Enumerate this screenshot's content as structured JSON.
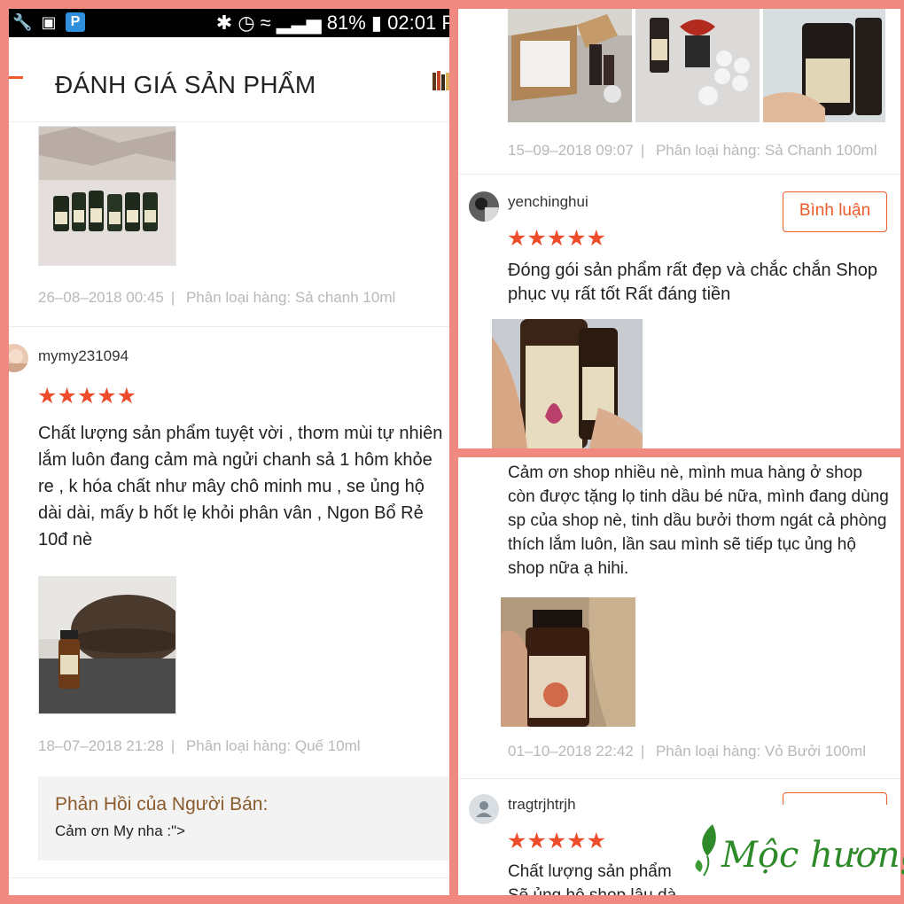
{
  "status_bar": {
    "battery": "81%",
    "time": "02:01 P"
  },
  "header": {
    "title": "ĐÁNH GIÁ SẢN PHẨM"
  },
  "left": {
    "review0": {
      "date": "26–08–2018 00:45",
      "category_label": "Phân loại hàng:",
      "category": "Sả chanh 10ml"
    },
    "review1": {
      "user": "mymy231094",
      "stars": "★★★★★",
      "text": "Chất lượng sản phẩm tuyệt vời , thơm mùi tự nhiên lắm luôn đang cảm mà ngửi chanh sả 1 hôm khỏe re , k hóa chất như mây chô minh mu , se ủng hộ dài dài, mấy b hốt lẹ khỏi phân vân , Ngon Bổ Rẻ 10đ nè",
      "date": "18–07–2018 21:28",
      "category_label": "Phân loại hàng:",
      "category": "Quế 10ml"
    },
    "seller_reply": {
      "title": "Phản Hồi của Người Bán:",
      "text": "Cảm ơn My nha :\">"
    }
  },
  "top_right": {
    "review0": {
      "date": "15–09–2018 09:07",
      "category_label": "Phân loại hàng:",
      "category": "Sả Chanh 100ml"
    },
    "review1": {
      "user": "yenchinghui",
      "stars": "★★★★★",
      "comment_button": "Bình luận",
      "text": "Đóng gói sản phẩm rất đẹp và chắc chắn Shop phục vụ rất tốt Rất đáng tiền"
    }
  },
  "bottom_right": {
    "review0": {
      "text": "Cảm ơn shop nhiều nè, mình mua hàng ở shop còn được tặng lọ tinh dầu bé nữa, mình đang dùng sp của shop nè, tinh dầu bưởi thơm ngát cả phòng thích lắm luôn, lần sau mình sẽ tiếp tục ủng hộ shop nữa ạ hihi.",
      "date": "01–10–2018 22:42",
      "category_label": "Phân loại hàng:",
      "category": "Vỏ Bưởi 100ml"
    },
    "review1": {
      "user": "tragtrjhtrjh",
      "stars": "★★★★★",
      "text_line1": "Chất lượng sản phẩm",
      "text_line2": "Sẽ ủng hộ shop lâu dà"
    }
  },
  "brand": {
    "logo_text": "Mộc hương"
  },
  "colors": {
    "accent": "#ee4d2d",
    "frame": "#f08a80",
    "logo_green": "#2f8a2a",
    "seller_title": "#8a5a2a"
  }
}
